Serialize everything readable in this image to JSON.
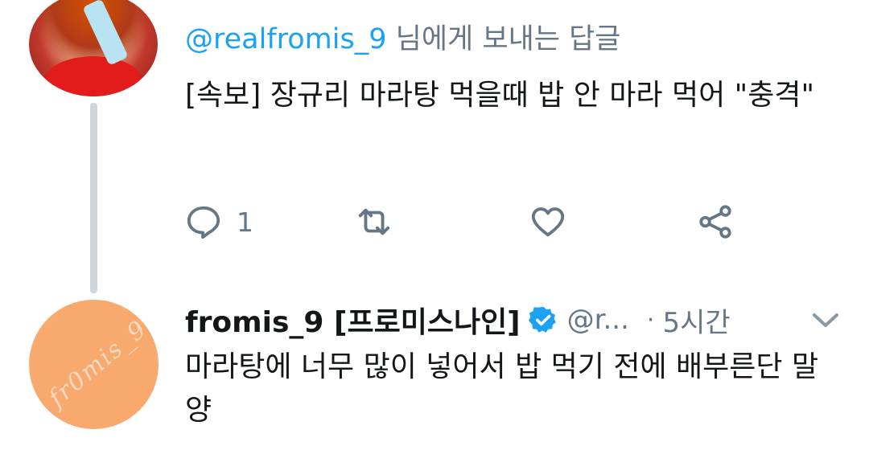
{
  "reply_context": {
    "handle": "@realfromis_9",
    "suffix": " 님에게 보내는 답글"
  },
  "tweet1": {
    "text": "[속보] 장규리 마라탕 먹을때 밥 안 마라 먹어 \"충격\"",
    "reply_count": "1",
    "icons": [
      "reply-icon",
      "retweet-icon",
      "like-icon",
      "share-icon"
    ]
  },
  "tweet2": {
    "display_name": "fromis_9 [프로미스나인]",
    "handle": "@r...",
    "separator": "·",
    "time": "5시간",
    "text": "마라탕에 너무 많이 넣어서 밥 먹기 전에 배부른단 말양",
    "avatar_text": "fr0mis_9"
  },
  "colors": {
    "accent": "#1da1f2",
    "secondary_text": "#657786",
    "thread_line": "#ccd6dd",
    "avatar2_bg": "#f7a96e"
  }
}
